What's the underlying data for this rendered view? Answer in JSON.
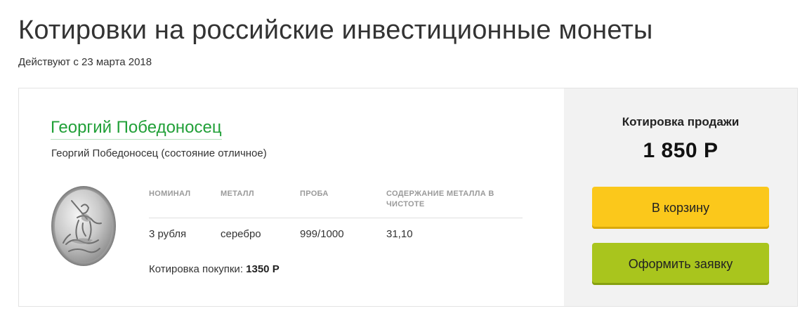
{
  "header": {
    "title": "Котировки на российские инвестиционные монеты",
    "subtitle": "Действуют с 23 марта 2018"
  },
  "coin": {
    "name": "Георгий Победоносец",
    "description": "Георгий Победоносец (состояние отличное)",
    "image_icon": "silver-coin-st-george-icon",
    "specs": {
      "headers": [
        "Номинал",
        "Металл",
        "Проба",
        "Содержание металла в чистоте"
      ],
      "values": [
        "3 рубля",
        "серебро",
        "999/1000",
        "31,10"
      ]
    },
    "buy_quote_label": "Котировка покупки:",
    "buy_quote_value": "1350 Р"
  },
  "sell": {
    "label": "Котировка продажи",
    "price": "1 850 Р",
    "cart_button": "В корзину",
    "order_button": "Оформить заявку"
  },
  "colors": {
    "title_green": "#21a038",
    "cart_yellow": "#fbc81b",
    "order_green": "#a9c51d",
    "side_panel_bg": "#f2f2f2"
  }
}
